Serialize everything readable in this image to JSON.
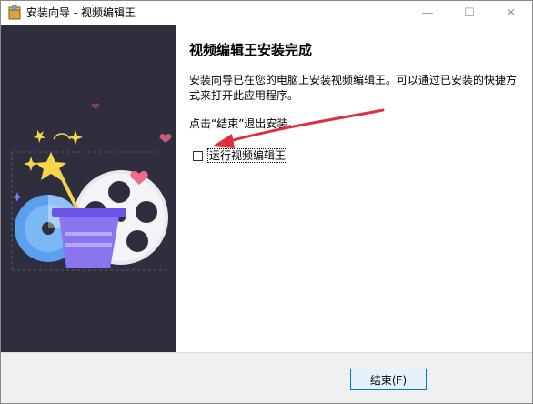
{
  "window": {
    "title": "安装向导 - 视频编辑王"
  },
  "titlebar": {
    "min_glyph": "—",
    "max_glyph": "☐",
    "close_glyph": "✕"
  },
  "content": {
    "heading": "视频编辑王安装完成",
    "description": "安装向导已在您的电脑上安装视频编辑王。可以通过已安装的快捷方式来打开此应用程序。",
    "hint": "点击“结束”退出安装。",
    "run_checkbox": {
      "label": "运行视频编辑王",
      "checked": false
    }
  },
  "buttons": {
    "finish": "结束(F)"
  },
  "colors": {
    "sidebar": "#2e2e3e",
    "accent": "#0078d7",
    "arrow": "#e0303c"
  },
  "icons": {
    "app": "installer-box-icon",
    "illustration": "magic-hat-film-reel-illustration"
  }
}
